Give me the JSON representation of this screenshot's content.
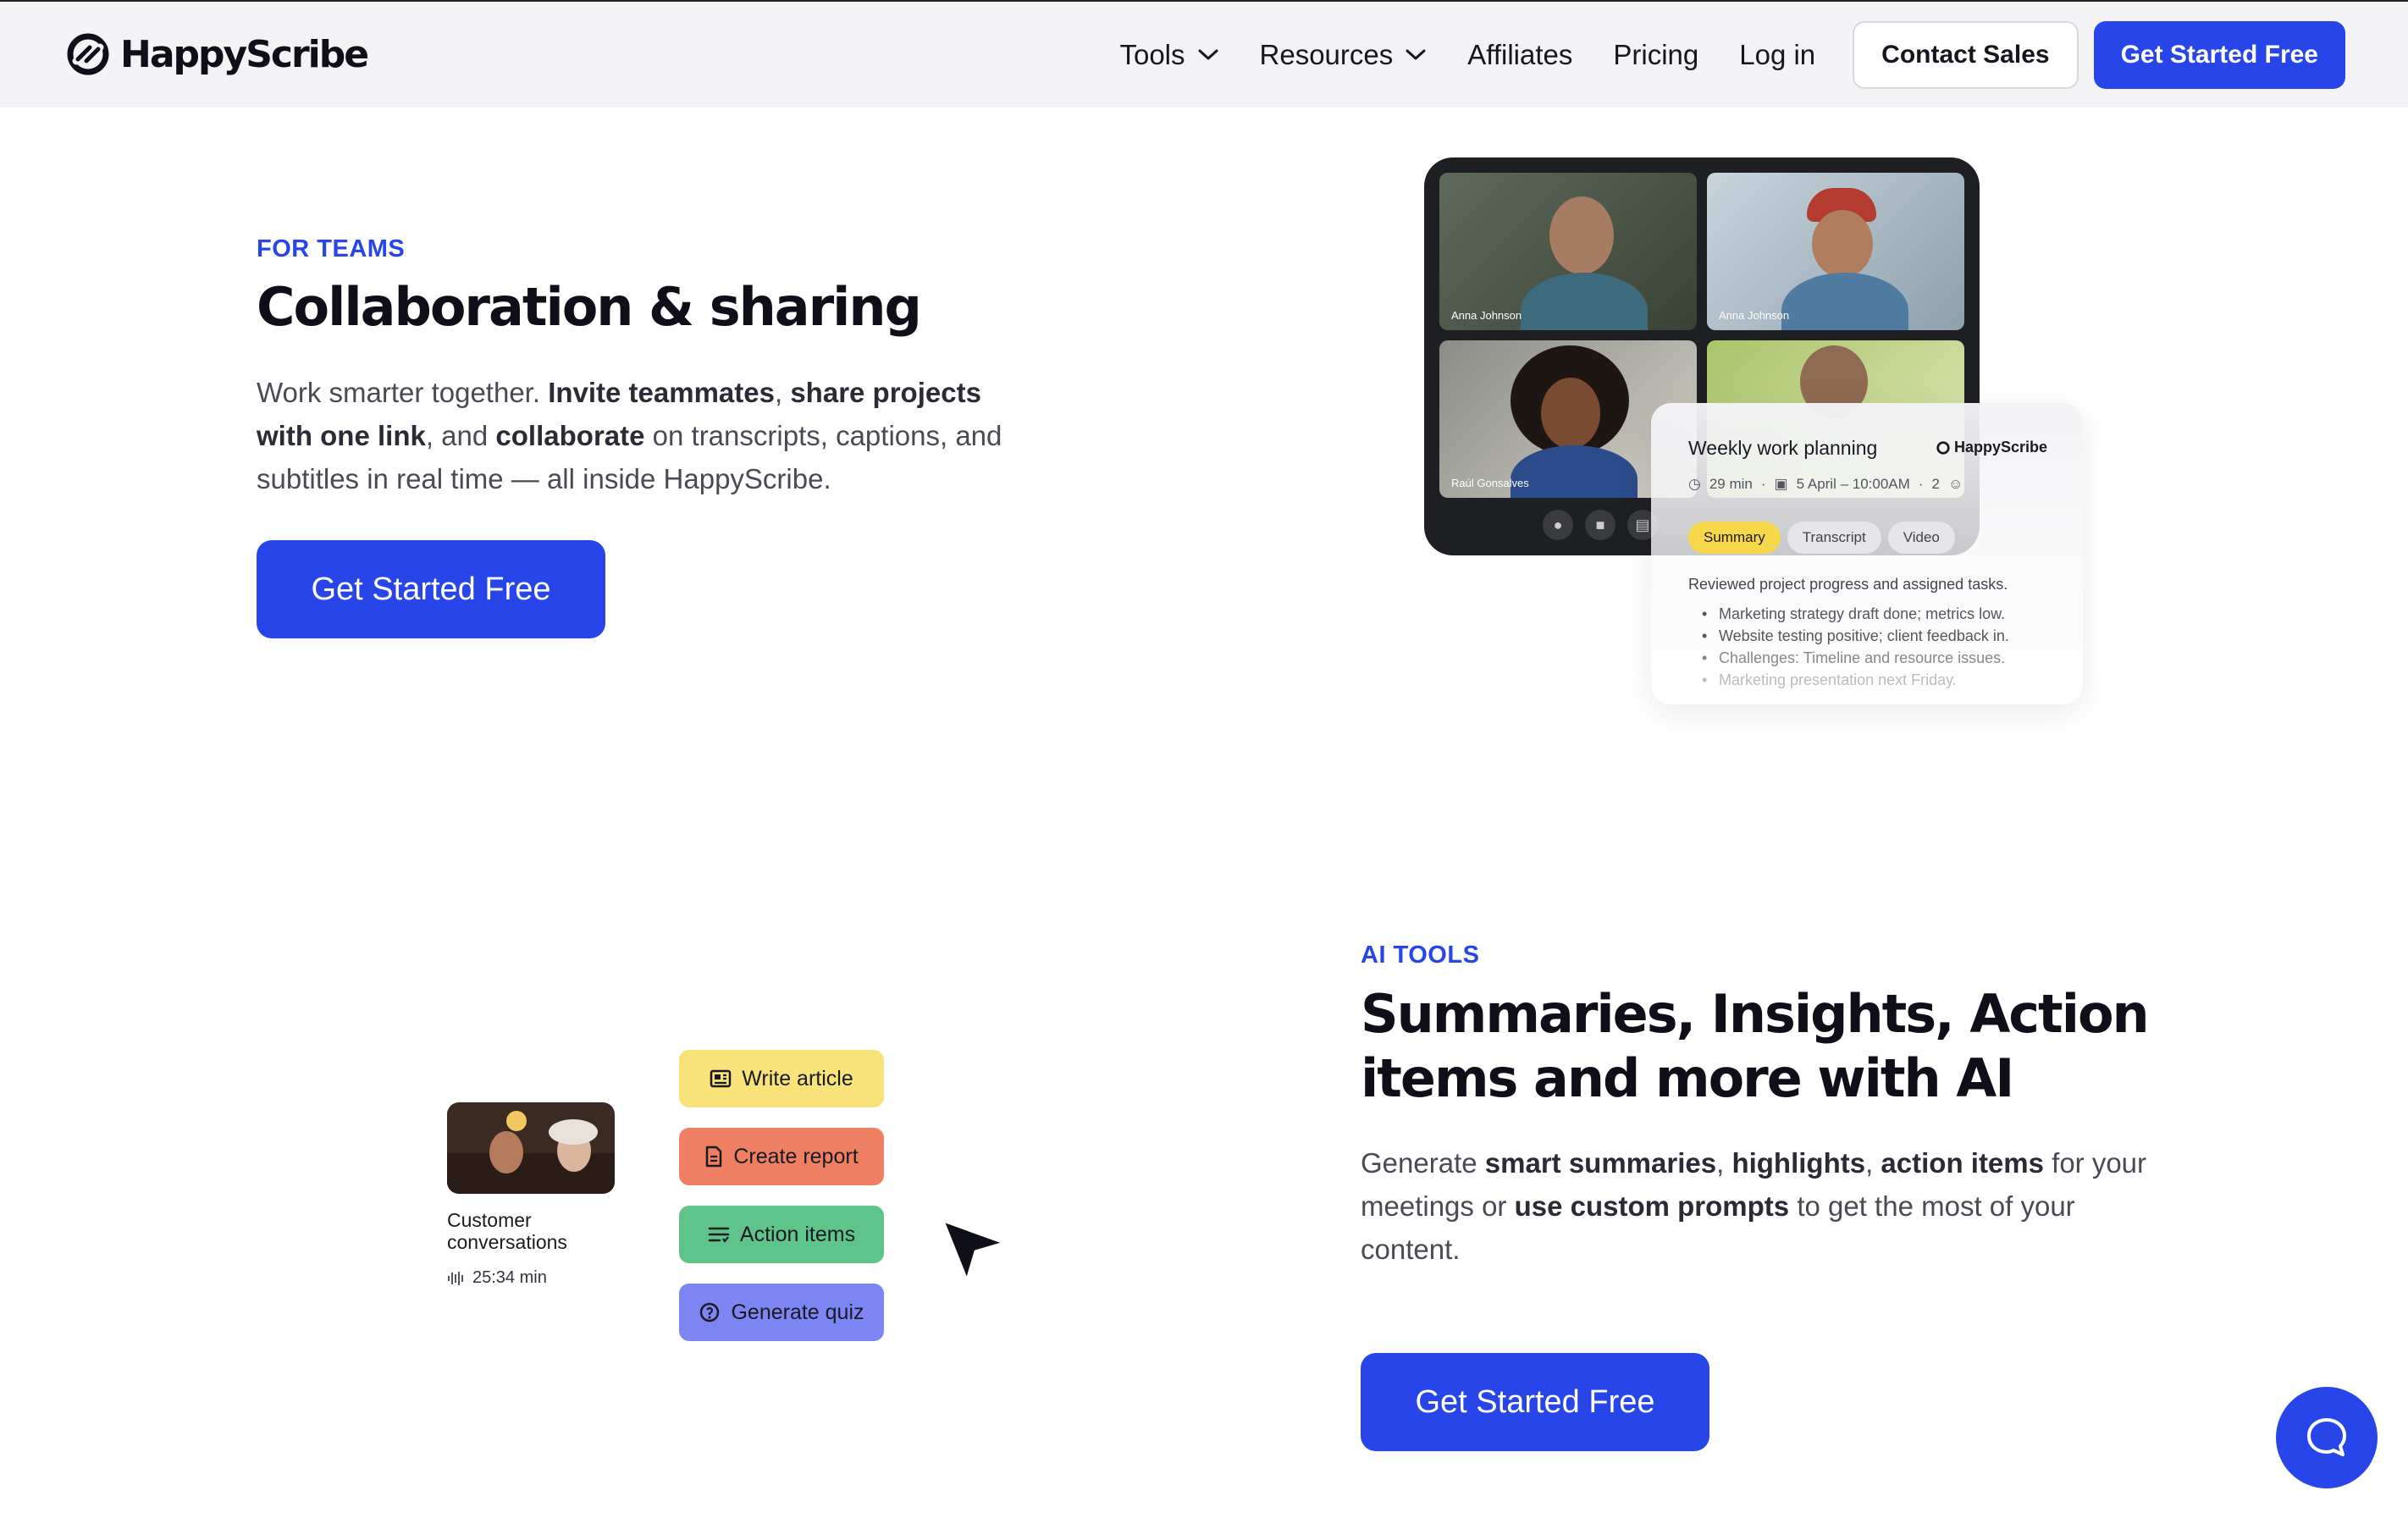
{
  "nav": {
    "logo_text": "HappyScribe",
    "links": [
      {
        "label": "Tools",
        "has_dropdown": true
      },
      {
        "label": "Resources",
        "has_dropdown": true
      },
      {
        "label": "Affiliates",
        "has_dropdown": false
      },
      {
        "label": "Pricing",
        "has_dropdown": false
      },
      {
        "label": "Log in",
        "has_dropdown": false
      }
    ],
    "contact_label": "Contact Sales",
    "cta_label": "Get Started Free"
  },
  "teams": {
    "eyebrow": "FOR TEAMS",
    "title": "Collaboration & sharing",
    "description_parts": [
      {
        "text": "Work smarter together. ",
        "bold": false
      },
      {
        "text": "Invite teammates",
        "bold": true
      },
      {
        "text": ", ",
        "bold": false
      },
      {
        "text": "share projects with one link",
        "bold": true
      },
      {
        "text": ", and ",
        "bold": false
      },
      {
        "text": "collaborate",
        "bold": true
      },
      {
        "text": " on transcripts, captions, and subtitles in real time — all inside HappyScribe.",
        "bold": false
      }
    ],
    "cta_label": "Get Started Free",
    "call": {
      "participants": [
        "Anna Johnson",
        "Anna Johnson",
        "Raúl Gonsalves",
        ""
      ],
      "summary": {
        "title": "Weekly work planning",
        "brand": "HappyScribe",
        "duration": "29 min",
        "date": "5 April – 10:00AM",
        "attendees": "2",
        "tabs": [
          "Summary",
          "Transcript",
          "Video"
        ],
        "active_tab": "Summary",
        "description": "Reviewed project progress and assigned tasks.",
        "points": [
          "Marketing strategy draft done; metrics low.",
          "Website testing positive; client feedback in.",
          "Challenges: Timeline and resource issues.",
          "Marketing presentation next Friday."
        ]
      }
    }
  },
  "ai": {
    "eyebrow": "AI TOOLS",
    "title_line1": "Summaries, Insights, Action",
    "title_line2": "items and more with AI",
    "description_parts": [
      {
        "text": "Generate ",
        "bold": false
      },
      {
        "text": "smart summaries",
        "bold": true
      },
      {
        "text": ", ",
        "bold": false
      },
      {
        "text": "highlights",
        "bold": true
      },
      {
        "text": ", ",
        "bold": false
      },
      {
        "text": "action items",
        "bold": true
      },
      {
        "text": " for your meetings or ",
        "bold": false
      },
      {
        "text": "use custom prompts",
        "bold": true
      },
      {
        "text": " to get the most of your content.",
        "bold": false
      }
    ],
    "cta_label": "Get Started Free",
    "media": {
      "label": "Customer conversations",
      "duration": "25:34 min"
    },
    "actions": [
      {
        "label": "Write article",
        "icon": "newspaper-icon",
        "color": "#f7e37a"
      },
      {
        "label": "Create report",
        "icon": "document-icon",
        "color": "#ee7f62"
      },
      {
        "label": "Action items",
        "icon": "list-icon",
        "color": "#5fc48a"
      },
      {
        "label": "Generate quiz",
        "icon": "quiz-icon",
        "color": "#7d85f2"
      }
    ]
  },
  "colors": {
    "brand_blue": "#2845ea",
    "nav_bg": "#f3f3f5"
  }
}
